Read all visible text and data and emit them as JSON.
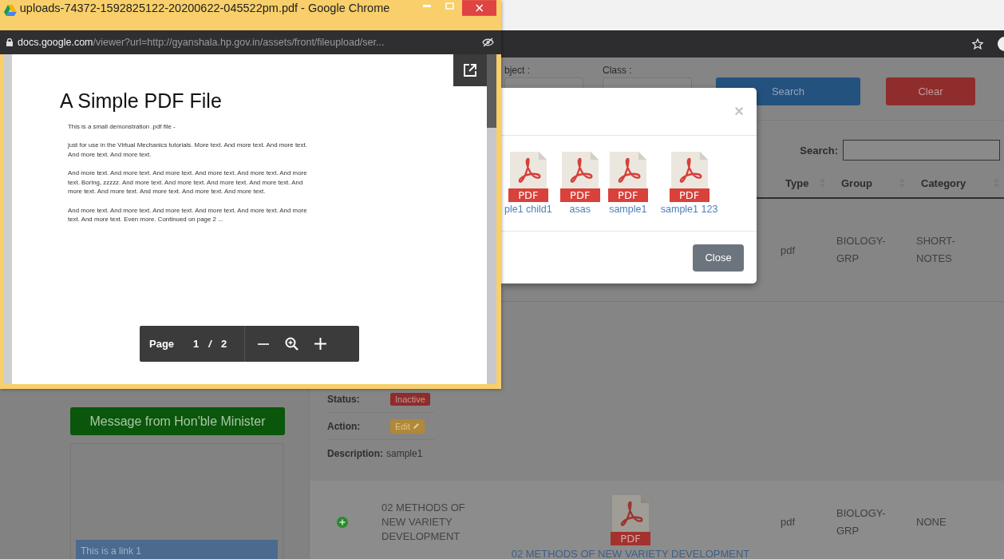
{
  "popup_window": {
    "title": "uploads-74372-1592825122-20200622-045522pm.pdf - Google Chrome",
    "address": {
      "host": "docs.google.com",
      "path": "/viewer?url=http://gyanshala.hp.gov.in/assets/front/fileupload/ser..."
    },
    "pdf": {
      "title": "A Simple PDF File",
      "paragraphs": [
        "This is a small demonstration .pdf file -",
        "just for use in the Virtual Mechanics tutorials. More text. And more text. And more text. And more text. And more text.",
        "And more text. And more text. And more text. And more text. And more text. And more text. Boring, zzzzz. And more text. And more text. And more text. And more text. And more text. And more text. And more text. And more text. And more text.",
        "And more text. And more text. And more text. And more text. And more text. And more text. And more text. Even more. Continued on page 2 ..."
      ]
    },
    "toolbar": {
      "page_label": "Page",
      "current": "1",
      "separator": "/",
      "total": "2"
    }
  },
  "filters": [
    {
      "label": "bject :"
    },
    {
      "label": "Class :"
    }
  ],
  "buttons": [
    {
      "label": "Search",
      "kind": "primary"
    },
    {
      "label": "Clear",
      "kind": "danger"
    }
  ],
  "table": {
    "search_label": "Search:",
    "columns": [
      "Type",
      "Group",
      "Category"
    ],
    "row_1": {
      "type": "pdf",
      "group": "BIOLOGY-GRP",
      "category": "SHORT-NOTES"
    },
    "details": [
      {
        "label": "Status:",
        "kind": "badge",
        "value": "Inactive"
      },
      {
        "label": "Action:",
        "kind": "edit",
        "value": "Edit"
      },
      {
        "label": "Description:",
        "kind": "text",
        "value": "sample1"
      }
    ],
    "row_2": {
      "name": "02 METHODS OF NEW VARIETY DEVELOPMENT",
      "file_badge": "PDF",
      "file_label": "02 METHODS OF NEW VARIETY DEVELOPMENT",
      "type": "pdf",
      "group": "BIOLOGY-GRP",
      "category": "NONE"
    }
  },
  "sidebar": {
    "button": "Message from Hon'ble Minister",
    "links": [
      "This is a link 1"
    ]
  },
  "modal": {
    "close_symbol": "×",
    "files": [
      {
        "badge": "PDF",
        "label": "ple1 child1"
      },
      {
        "badge": "PDF",
        "label": "asas"
      },
      {
        "badge": "PDF",
        "label": "sample1"
      },
      {
        "badge": "PDF",
        "label": "sample1 123"
      }
    ],
    "close_button": "Close"
  }
}
